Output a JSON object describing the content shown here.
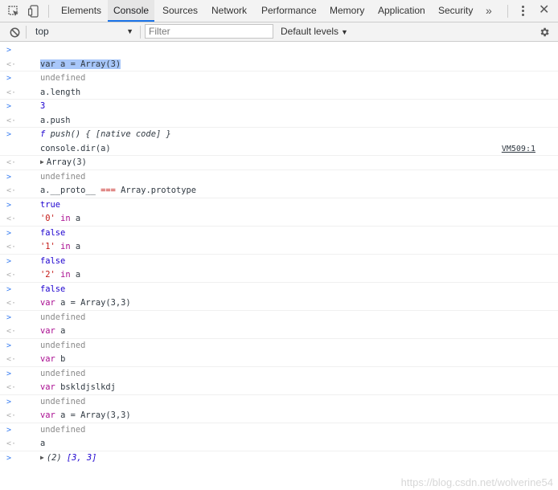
{
  "tabs": [
    {
      "label": "Elements",
      "active": false
    },
    {
      "label": "Console",
      "active": true
    },
    {
      "label": "Sources",
      "active": false
    },
    {
      "label": "Network",
      "active": false
    },
    {
      "label": "Performance",
      "active": false
    },
    {
      "label": "Memory",
      "active": false
    },
    {
      "label": "Application",
      "active": false
    },
    {
      "label": "Security",
      "active": false
    }
  ],
  "tabbar": {
    "more_tabs_label": "»",
    "close_label": "✕",
    "accent_color": "#1a73e8"
  },
  "toolbar": {
    "context_value": "top",
    "dropdown_arrow": "▼",
    "filter_placeholder": "Filter",
    "levels_label": "Default levels",
    "levels_arrow": "▼"
  },
  "console": {
    "input_prompt": ">",
    "result_marker": "<·",
    "expand_marker": "▶",
    "entries": [
      {
        "kind": "input",
        "text": "var a = Array(3)"
      },
      {
        "kind": "result",
        "text": "undefined"
      },
      {
        "kind": "input",
        "text": "a.length"
      },
      {
        "kind": "result",
        "text": "3"
      },
      {
        "kind": "input",
        "text": "a.push"
      },
      {
        "kind": "result",
        "fn_symbol": "f",
        "fn_name": "push() {",
        "fn_body": "[native code]",
        "fn_close": "}"
      },
      {
        "kind": "input",
        "text": "console.dir(a)"
      },
      {
        "kind": "log",
        "text": "Array(3)",
        "source": "VM509:1"
      },
      {
        "kind": "result",
        "text": "undefined"
      },
      {
        "kind": "input",
        "prefix": "a.__proto__",
        "op": "===",
        "suffix": "Array.prototype"
      },
      {
        "kind": "result",
        "text": "true"
      },
      {
        "kind": "input",
        "str": "'0'",
        "op": "in",
        "rest": "a"
      },
      {
        "kind": "result",
        "text": "false"
      },
      {
        "kind": "input",
        "str": "'1'",
        "op": "in",
        "rest": "a"
      },
      {
        "kind": "result",
        "text": "false"
      },
      {
        "kind": "input",
        "str": "'2'",
        "op": "in",
        "rest": "a"
      },
      {
        "kind": "result",
        "text": "false"
      },
      {
        "kind": "input",
        "keyword": "var",
        "rest": "a = Array(3,3)"
      },
      {
        "kind": "result",
        "text": "undefined"
      },
      {
        "kind": "input",
        "keyword": "var",
        "rest": "a"
      },
      {
        "kind": "result",
        "text": "undefined"
      },
      {
        "kind": "input",
        "keyword": "var",
        "rest": "b"
      },
      {
        "kind": "result",
        "text": "undefined"
      },
      {
        "kind": "input",
        "keyword": "var",
        "rest": "bskldjslkdj"
      },
      {
        "kind": "result",
        "text": "undefined"
      },
      {
        "kind": "input",
        "keyword": "var",
        "rest": "a = Array(3,3)"
      },
      {
        "kind": "result",
        "text": "undefined"
      },
      {
        "kind": "input",
        "text": "a"
      },
      {
        "kind": "result",
        "count": "(2)",
        "array": "[3, 3]"
      }
    ]
  },
  "watermark": "https://blog.csdn.net/wolverine54"
}
